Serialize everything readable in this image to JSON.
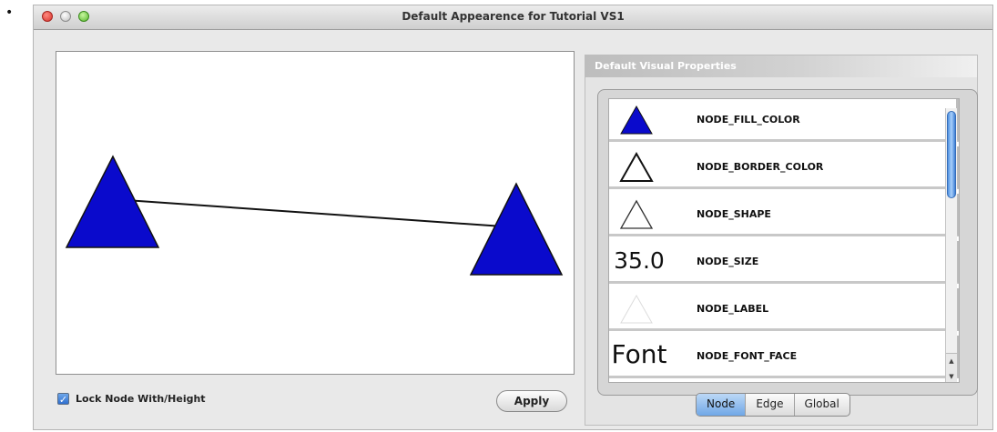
{
  "bullet": "•",
  "window": {
    "title": "Default Appearence for Tutorial VS1"
  },
  "preview": {
    "node_fill_color": "#0a0acc",
    "edge_color": "#111111"
  },
  "lock": {
    "checked": true,
    "check_glyph": "✓",
    "label": "Lock Node With/Height"
  },
  "apply_label": "Apply",
  "panel": {
    "header": "Default Visual Properties",
    "properties": [
      {
        "icon": "filled-triangle",
        "label": "NODE_FILL_COLOR"
      },
      {
        "icon": "outline-triangle",
        "label": "NODE_BORDER_COLOR"
      },
      {
        "icon": "outline-triangle",
        "label": "NODE_SHAPE"
      },
      {
        "icon_text": "35.0",
        "label": "NODE_SIZE"
      },
      {
        "icon": "faint-triangle",
        "label": "NODE_LABEL"
      },
      {
        "icon_text": "Font",
        "label": "NODE_FONT_FACE"
      }
    ],
    "tabs": [
      {
        "label": "Node",
        "active": true
      },
      {
        "label": "Edge",
        "active": false
      },
      {
        "label": "Global",
        "active": false
      }
    ]
  }
}
